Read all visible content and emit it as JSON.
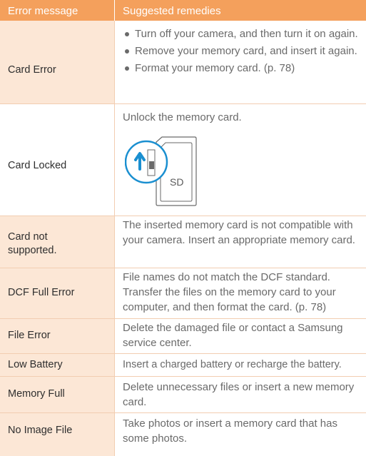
{
  "header": {
    "col1": "Error message",
    "col2": "Suggested remedies"
  },
  "rows": [
    {
      "label": "Card Error",
      "remedies": [
        "Turn off your camera, and then turn it on again.",
        "Remove your memory card, and insert it again.",
        "Format your memory card. (p. 78)"
      ]
    },
    {
      "label": "Card Locked",
      "remedy": "Unlock the memory card.",
      "card_text": "SD"
    },
    {
      "label_line1": "Card not",
      "label_line2": "supported.",
      "remedy": "The inserted memory card is not compatible with your camera. Insert an appropriate memory card."
    },
    {
      "label": "DCF Full Error",
      "remedy": "File names do not match the DCF standard. Transfer the files on the memory card to your computer, and then format the card. (p. 78)"
    },
    {
      "label": "File Error",
      "remedy": "Delete the damaged file or contact a Samsung service center."
    },
    {
      "label": "Low Battery",
      "remedy": "Insert a charged battery or recharge the battery."
    },
    {
      "label": "Memory Full",
      "remedy": "Delete unnecessary files or insert a new memory card."
    },
    {
      "label": "No Image File",
      "remedy": "Take photos or insert a memory card that has some photos."
    }
  ],
  "colors": {
    "header": "#f4a05c",
    "label_shade": "#fce7d6",
    "accent_blue": "#1a8fd0"
  }
}
